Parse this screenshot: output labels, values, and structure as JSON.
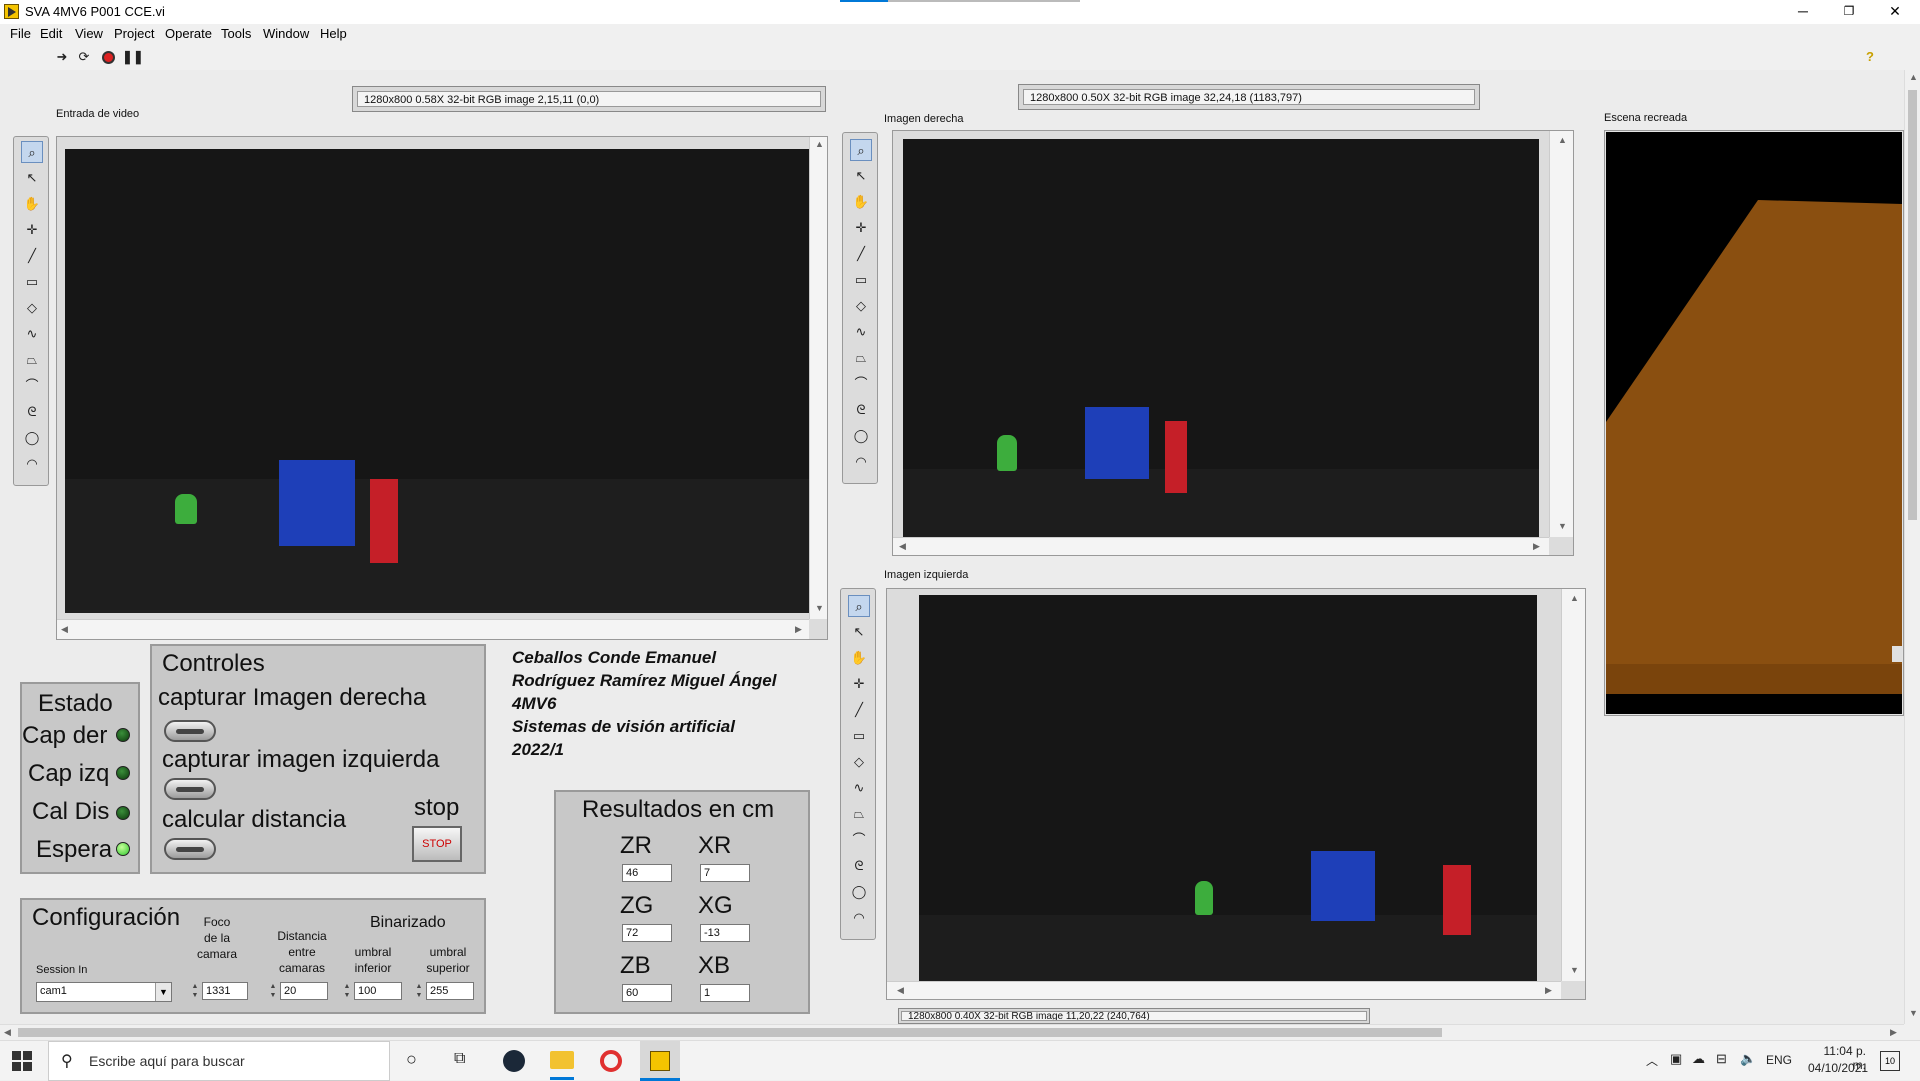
{
  "window": {
    "title": "SVA 4MV6 P001 CCE.vi",
    "min": "─",
    "restore": "❐",
    "close": "✕"
  },
  "menu": [
    "File",
    "Edit",
    "View",
    "Project",
    "Operate",
    "Tools",
    "Window",
    "Help"
  ],
  "toolbar": {
    "help": "?"
  },
  "video_in": {
    "label": "Entrada de video",
    "info": "1280x800 0.58X 32-bit RGB image 2,15,11    (0,0)"
  },
  "right_img": {
    "label": "Imagen derecha",
    "info": "1280x800 0.50X 32-bit RGB image 32,24,18    (1183,797)"
  },
  "left_img": {
    "label": "Imagen izquierda",
    "info": "1280x800 0.40X 32-bit RGB image 11,20,22    (240,764)"
  },
  "scene": {
    "label": "Escena recreada"
  },
  "estado": {
    "title": "Estado",
    "items": [
      "Cap der",
      "Cap izq",
      "Cal Dis",
      "Espera"
    ],
    "on": [
      false,
      false,
      false,
      true
    ]
  },
  "controles": {
    "title": "Controles",
    "btn1": "capturar Imagen derecha",
    "btn2": "capturar imagen izquierda",
    "btn3": "calcular distancia",
    "stop_label": "stop",
    "stop_btn": "STOP"
  },
  "credits": {
    "line1": "Ceballos Conde Emanuel",
    "line2": "Rodríguez Ramírez Miguel Ángel",
    "line3": "4MV6",
    "line4": "Sistemas de visión artificial",
    "line5": "2022/1"
  },
  "resultados": {
    "title": "Resultados en cm",
    "ZR": {
      "label": "ZR",
      "value": "46"
    },
    "XR": {
      "label": "XR",
      "value": "7"
    },
    "ZG": {
      "label": "ZG",
      "value": "72"
    },
    "XG": {
      "label": "XG",
      "value": "-13"
    },
    "ZB": {
      "label": "ZB",
      "value": "60"
    },
    "XB": {
      "label": "XB",
      "value": "1"
    }
  },
  "config": {
    "title": "Configuración",
    "session_label": "Session In",
    "session_value": "cam1",
    "foco_label_1": "Foco",
    "foco_label_2": "de la",
    "foco_label_3": "camara",
    "foco_value": "1331",
    "dist_label_1": "Distancia",
    "dist_label_2": "entre",
    "dist_label_3": "camaras",
    "dist_value": "20",
    "binarizado": "Binarizado",
    "uinf_label_1": "umbral",
    "uinf_label_2": "inferior",
    "uinf_value": "100",
    "usup_label_1": "umbral",
    "usup_label_2": "superior",
    "usup_value": "255"
  },
  "taskbar": {
    "search_placeholder": "Escribe aquí para buscar",
    "lang": "ENG",
    "time": "11:04 p. m.",
    "date": "04/10/2021",
    "notif": "10"
  },
  "colors": {
    "scene_bg": "#000000",
    "scene_plane": "#8a4f10",
    "panel": "#ececec",
    "group": "#c8c8c8"
  }
}
